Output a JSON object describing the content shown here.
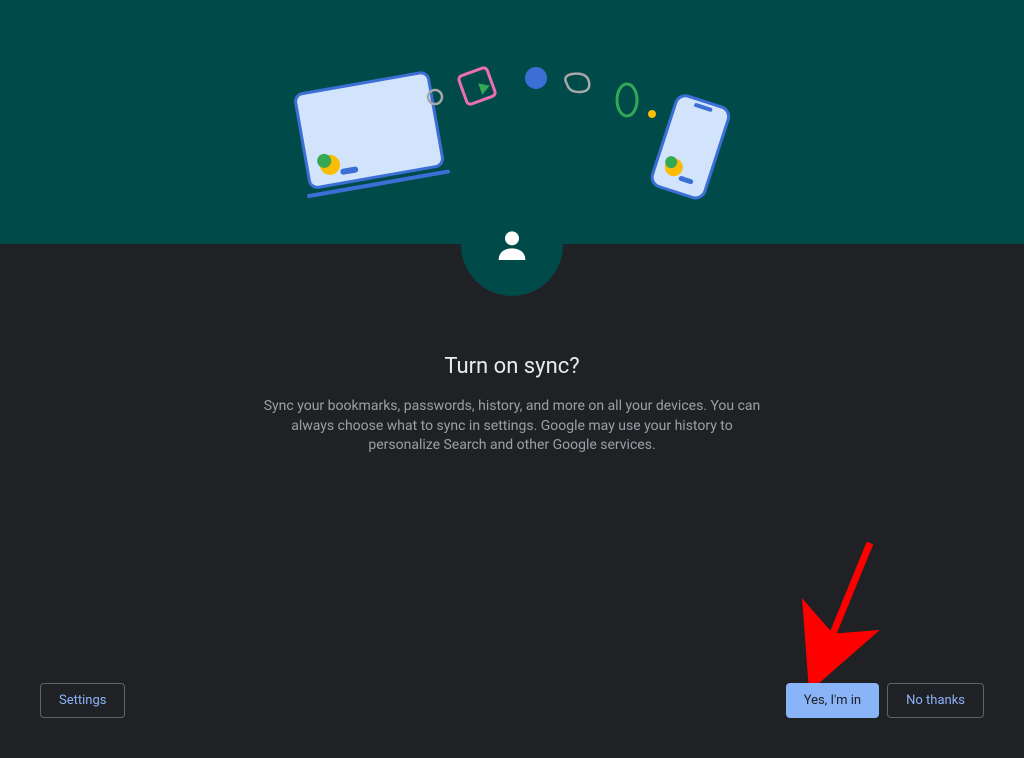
{
  "dialog": {
    "title": "Turn on sync?",
    "description": "Sync your bookmarks, passwords, history, and more on all your devices. You can always choose what to sync in settings. Google may use your history to personalize Search and other Google services."
  },
  "footer": {
    "settings_label": "Settings",
    "yes_label": "Yes, I'm in",
    "no_label": "No thanks"
  },
  "colors": {
    "hero_bg": "#004a4a",
    "page_bg": "#202124",
    "accent": "#8ab4f8"
  }
}
